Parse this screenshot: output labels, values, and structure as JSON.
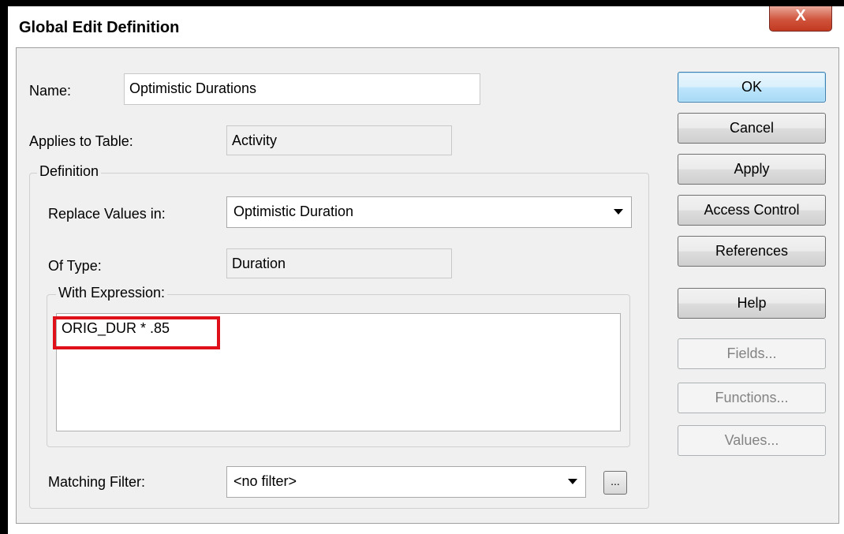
{
  "window": {
    "title": "Global Edit Definition",
    "close_glyph": "X"
  },
  "form": {
    "name_label": "Name:",
    "name_value": "Optimistic Durations",
    "applies_label": "Applies to Table:",
    "applies_value": "Activity",
    "definition_legend": "Definition",
    "replace_label": "Replace Values in:",
    "replace_value": "Optimistic Duration",
    "type_label": "Of Type:",
    "type_value": "Duration",
    "expression_legend": "With Expression:",
    "expression_value": "ORIG_DUR * .85",
    "filter_label": "Matching Filter:",
    "filter_value": "<no filter>",
    "ellipsis": "..."
  },
  "buttons": {
    "ok": "OK",
    "cancel": "Cancel",
    "apply": "Apply",
    "access_control": "Access Control",
    "references": "References",
    "help": "Help",
    "fields": "Fields...",
    "functions": "Functions...",
    "values": "Values..."
  },
  "colors": {
    "highlight": "#e0101a",
    "default_button": "#a7d9f5",
    "close_button": "#c23a22"
  }
}
